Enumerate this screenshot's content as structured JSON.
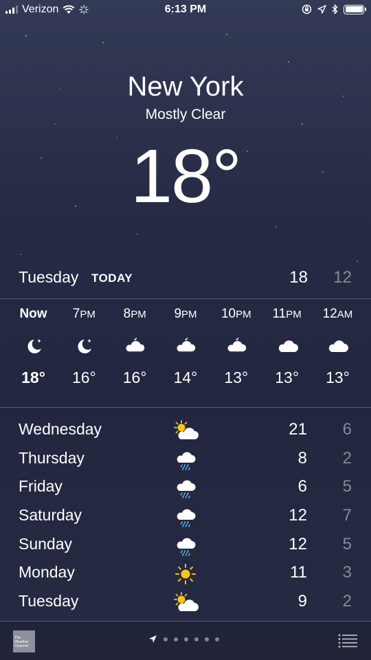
{
  "status_bar": {
    "carrier": "Verizon",
    "time": "6:13 PM",
    "battery_level": 1.0
  },
  "location": {
    "city": "New York",
    "condition": "Mostly Clear",
    "temperature": "18°"
  },
  "today": {
    "day": "Tuesday",
    "label": "TODAY",
    "high": "18",
    "low": "12"
  },
  "hourly": [
    {
      "time": "Now",
      "icon": "moon-icon",
      "temp": "18°"
    },
    {
      "time": "7PM",
      "icon": "moon-icon",
      "temp": "16°"
    },
    {
      "time": "8PM",
      "icon": "partly-cloudy-night-icon",
      "temp": "16°"
    },
    {
      "time": "9PM",
      "icon": "partly-cloudy-night-icon",
      "temp": "14°"
    },
    {
      "time": "10PM",
      "icon": "partly-cloudy-night-icon",
      "temp": "13°"
    },
    {
      "time": "11PM",
      "icon": "cloud-icon",
      "temp": "13°"
    },
    {
      "time": "12AM",
      "icon": "cloud-icon",
      "temp": "13°"
    }
  ],
  "daily": [
    {
      "day": "Wednesday",
      "icon": "partly-sunny-icon",
      "high": "21",
      "low": "6"
    },
    {
      "day": "Thursday",
      "icon": "rain-icon",
      "high": "8",
      "low": "2"
    },
    {
      "day": "Friday",
      "icon": "rain-icon",
      "high": "6",
      "low": "5"
    },
    {
      "day": "Saturday",
      "icon": "rain-icon",
      "high": "12",
      "low": "7"
    },
    {
      "day": "Sunday",
      "icon": "rain-icon",
      "high": "12",
      "low": "5"
    },
    {
      "day": "Monday",
      "icon": "sun-icon",
      "high": "11",
      "low": "3"
    },
    {
      "day": "Tuesday",
      "icon": "partly-sunny-icon",
      "high": "9",
      "low": "2"
    }
  ],
  "bottom_bar": {
    "provider_logo_text": "The Weather Channel",
    "page_count": 6
  },
  "colors": {
    "sun": "#f5c518",
    "rain": "#4fa3e0",
    "background": "#262a42"
  }
}
